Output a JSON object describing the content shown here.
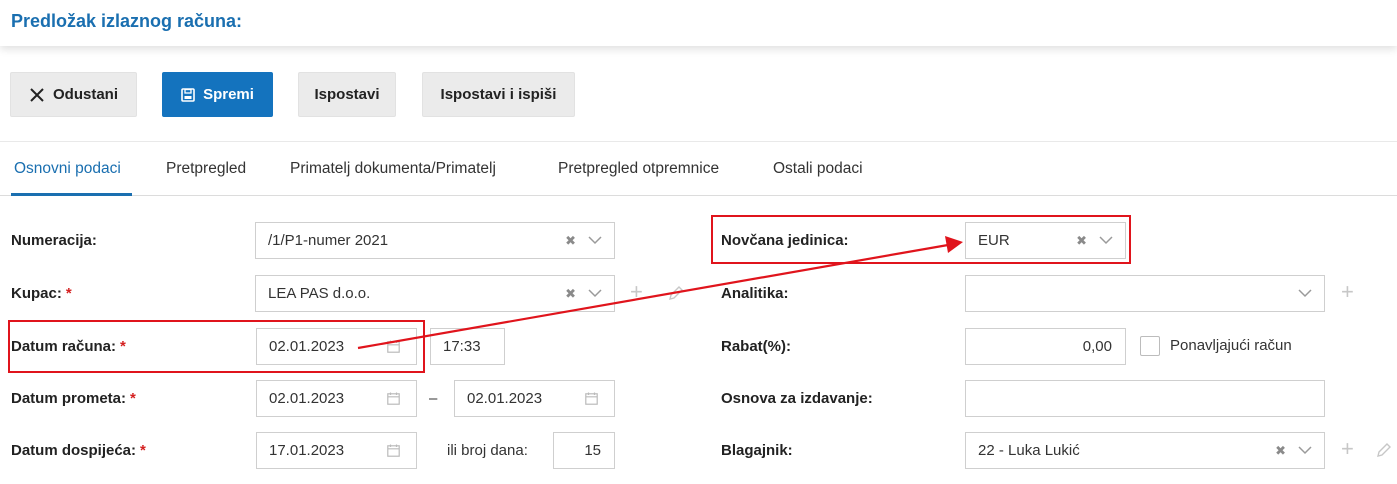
{
  "header": {
    "title": "Predložak izlaznog računa:"
  },
  "toolbar": {
    "cancel_label": "Odustani",
    "save_label": "Spremi",
    "issue_label": "Ispostavi",
    "issue_print_label": "Ispostavi i ispiši"
  },
  "tabs": [
    {
      "label": "Osnovni podaci",
      "active": true
    },
    {
      "label": "Pretpregled"
    },
    {
      "label": "Primatelj dokumenta/Primatelj"
    },
    {
      "label": "Pretpregled otpremnice"
    },
    {
      "label": "Ostali podaci"
    }
  ],
  "form": {
    "numeracija": {
      "label": "Numeracija:",
      "value": "/1/P1-numer 2021"
    },
    "kupac": {
      "label": "Kupac:",
      "required": "*",
      "value": "LEA PAS d.o.o."
    },
    "datum_racuna": {
      "label": "Datum računa:",
      "required": "*",
      "date": "02.01.2023",
      "time": "17:33"
    },
    "datum_prometa": {
      "label": "Datum prometa:",
      "required": "*",
      "from": "02.01.2023",
      "dash": "–",
      "to": "02.01.2023"
    },
    "datum_dospijeca": {
      "label": "Datum dospijeća:",
      "required": "*",
      "date": "17.01.2023",
      "days_label": "ili broj dana:",
      "days": "15"
    },
    "novcana_jedinica": {
      "label": "Novčana jedinica:",
      "value": "EUR"
    },
    "analitika": {
      "label": "Analitika:",
      "value": ""
    },
    "rabat": {
      "label": "Rabat(%):",
      "value": "0,00",
      "recurring_label": "Ponavljajući račun",
      "recurring_checked": false
    },
    "osnova": {
      "label": "Osnova za izdavanje:",
      "value": ""
    },
    "blagajnik": {
      "label": "Blagajnik:",
      "value": "22 - Luka Lukić"
    }
  },
  "colors": {
    "accent": "#1a6fb0",
    "primary_button": "#1473be",
    "highlight": "#e0141c",
    "required": "#d42020"
  },
  "icons": [
    "close-icon",
    "save-icon",
    "clear-icon",
    "chevron-down-icon",
    "calendar-icon",
    "plus-icon",
    "pencil-icon"
  ]
}
